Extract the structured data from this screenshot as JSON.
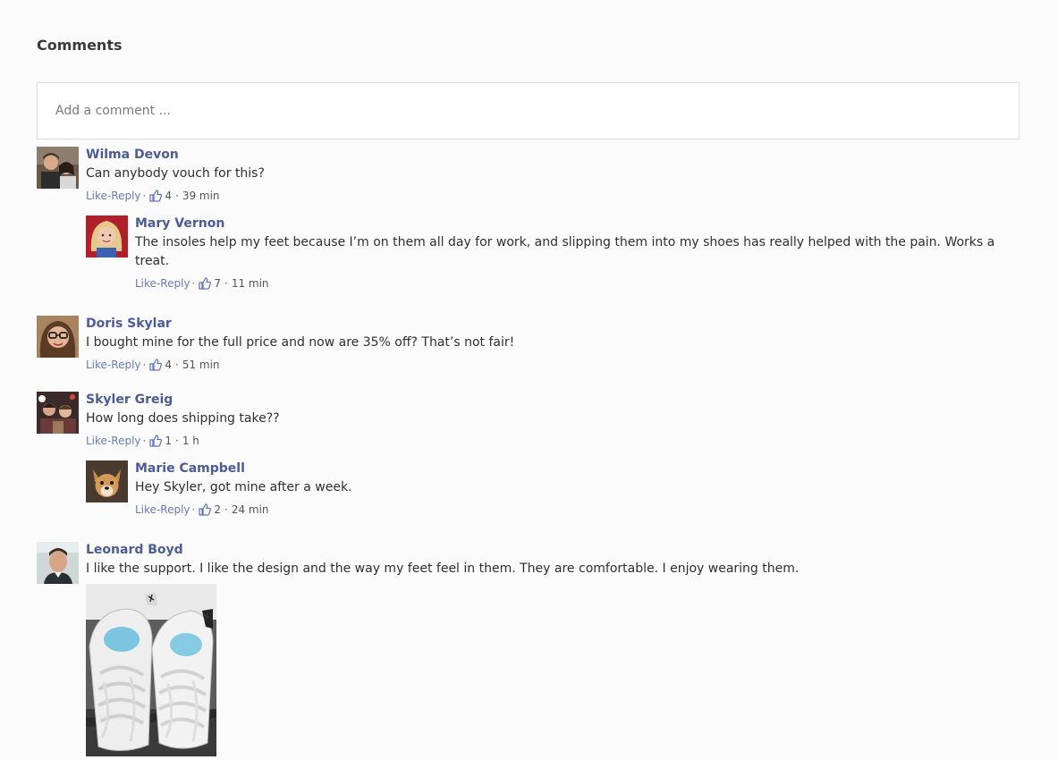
{
  "comments_section": {
    "title": "Comments",
    "input_placeholder": "Add a comment ..."
  },
  "meta_labels": {
    "like": "Like",
    "reply": "-Reply",
    "dot": "·"
  },
  "comments": [
    {
      "name": "Wilma Devon",
      "text": "Can anybody vouch for this?",
      "likes": "4",
      "time": "39 min",
      "avatar_icon": "couple-photo-avatar"
    },
    {
      "name": "Mary Vernon",
      "text_line1": "The insoles help my feet because I’m on them all day for work, and slipping them into my shoes has really helped with the pain. Works a",
      "text_line2": "treat.",
      "likes": "7",
      "time": "11 min",
      "avatar_icon": "blonde-woman-avatar"
    },
    {
      "name": "Doris Skylar",
      "text": "I bought mine for the full price and now are 35% off? That’s not fair!",
      "likes": "4",
      "time": "51 min",
      "avatar_icon": "woman-glasses-avatar"
    },
    {
      "name": "Skyler Greig",
      "text": "How long does shipping take??",
      "likes": "1",
      "time": "1 h",
      "avatar_icon": "group-photo-avatar"
    },
    {
      "name": "Marie Campbell",
      "text": "Hey Skyler, got mine after a week.",
      "likes": "2",
      "time": "24 min",
      "avatar_icon": "dog-avatar"
    },
    {
      "name": "Leonard Boyd",
      "text": "I like the support. I like the design and the way my feet feel in them. They are comfortable. I enjoy wearing them.",
      "avatar_icon": "man-avatar",
      "attachment_icon": "sneakers-with-insoles-photo"
    }
  ],
  "colors": {
    "name_link": "#4b5c97",
    "meta_link": "#6a7bb5",
    "thumb_icon": "#5b72c0"
  }
}
